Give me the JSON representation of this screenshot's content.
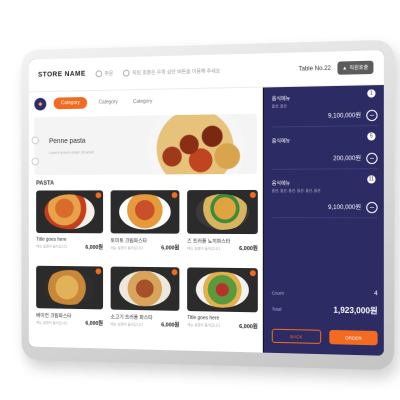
{
  "header": {
    "store_name": "STORE NAME",
    "info_1": "주문",
    "info_2": "직원 호출은 우측 상단 버튼을 이용해 주세요",
    "table_no": "Table No.22",
    "call_button": "직원호출"
  },
  "categories": [
    {
      "label": "Category",
      "active": true
    },
    {
      "label": "Category",
      "active": false
    },
    {
      "label": "Category",
      "active": false
    }
  ],
  "banner": {
    "title": "Penne pasta",
    "subtitle": "Lorem ipsum dolor sit amet"
  },
  "section_title": "PASTA",
  "menu": [
    {
      "name": "Title goes here",
      "desc": "메뉴 설명이 들어갑니다",
      "price": "6,000원"
    },
    {
      "name": "토마토 크림파스타",
      "desc": "메뉴 설명이 들어갑니다",
      "price": "6,000원"
    },
    {
      "name": "즈 트러플 뇨끼파스타",
      "desc": "메뉴 설명이 들어갑니다",
      "price": "6,000원"
    },
    {
      "name": "베이컨 크림파스타",
      "desc": "메뉴 설명이 들어갑니다",
      "price": "6,000원"
    },
    {
      "name": "소고기 트러플 파스타",
      "desc": "메뉴 설명이 들어갑니다",
      "price": "6,000원"
    },
    {
      "name": "Title goes here",
      "desc": "메뉴 설명이 들어갑니다",
      "price": "6,000원"
    }
  ],
  "cart": {
    "items": [
      {
        "qty": "1",
        "name": "음식메뉴",
        "option": "옵션, 옵션",
        "price": "9,100,000원"
      },
      {
        "qty": "5",
        "name": "음식메뉴",
        "option": "",
        "price": "200,000원"
      },
      {
        "qty": "11",
        "name": "음식메뉴",
        "option": "옵션, 옵션, 옵션, 옵션, 옵션, 옵션",
        "price": "9,100,000원"
      }
    ],
    "count_label": "Count",
    "count_value": "4",
    "total_label": "Total",
    "total_value": "1,923,000원",
    "secondary_button": "BACK",
    "primary_button": "ORDER"
  },
  "colors": {
    "accent": "#f26b21",
    "cart_bg": "#2d2b63"
  }
}
